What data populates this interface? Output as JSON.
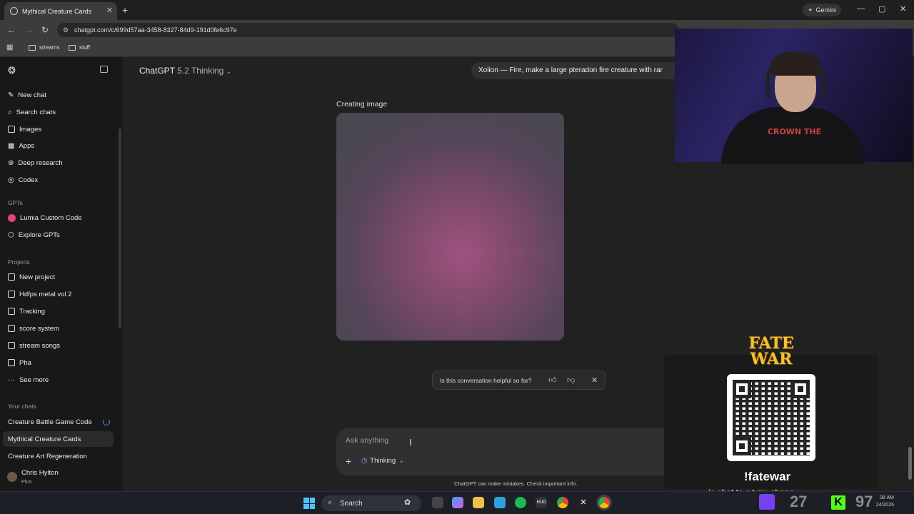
{
  "browser": {
    "tab_title": "Mythical Creature Cards",
    "gemini_label": "Gemini",
    "url": "chatgpt.com/c/699d57aa-3458-8327-84d9-191d0fe6c97e",
    "bookmarks": [
      "streams",
      "stuff"
    ]
  },
  "sidebar": {
    "nav": [
      "New chat",
      "Search chats",
      "Images",
      "Apps",
      "Deep research",
      "Codex"
    ],
    "gpts_heading": "GPTs",
    "gpts": [
      "Lumia Custom Code",
      "Explore GPTs"
    ],
    "projects_heading": "Projects",
    "projects": [
      "New project",
      "Hdfps metal vol 2",
      "Tracking",
      "score system",
      "stream songs",
      "Pha",
      "See more"
    ],
    "chats_heading": "Your chats",
    "chats": [
      "Creature Battle Game Code",
      "Mythical Creature Cards",
      "Creature Art Regeneration"
    ],
    "user_name": "Chris Hylton",
    "user_plan": "Plus"
  },
  "main": {
    "model_name": "ChatGPT",
    "model_version": "5.2 Thinking",
    "prompt_preview": "Xolion — Fire, make a large pteradon fire creature with rar",
    "creating_label": "Creating image",
    "feedback_question": "Is this conversation helpful so far?",
    "composer_placeholder": "Ask anything",
    "thinking_label": "Thinking",
    "disclaimer": "ChatGPT can make mistakes. Check important info."
  },
  "overlay": {
    "shirt_print": "CROWN THE",
    "logo_line1": "FATE",
    "logo_line2": "WAR",
    "command": "!fatewar",
    "chat_line": "in chat to s     t my chann   ",
    "tray_count_1": "27",
    "tray_count_2": "97",
    "kick_letter": "K"
  },
  "taskbar": {
    "search_label": "Search",
    "time": "08 AM",
    "date": "24/2026"
  },
  "colors": {
    "accent_blue": "#8ab4f8",
    "image_magenta": "#a0527f",
    "twitch": "#7b3ff2",
    "kick": "#53fc18"
  }
}
